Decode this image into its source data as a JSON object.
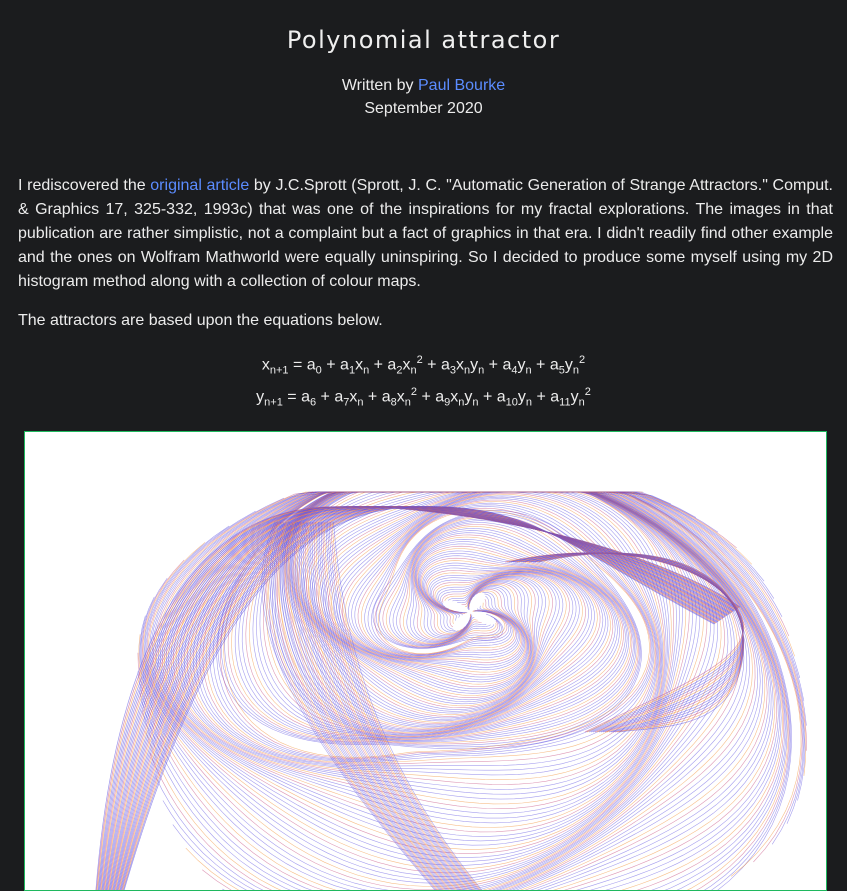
{
  "header": {
    "title": "Polynomial attractor",
    "written_by": "Written by",
    "author": "Paul Bourke",
    "date": "September 2020"
  },
  "intro": {
    "before_link": "I rediscovered the ",
    "link_text": "original article",
    "after_link": " by J.C.Sprott (Sprott, J. C. \"Automatic Generation of Strange Attractors.\" Comput. & Graphics 17, 325-332, 1993c) that was one of the inspirations for my fractal explorations. The images in that publication are rather simplistic, not a complaint but a fact of graphics in that era. I didn't readily find other example and the ones on Wolfram Mathworld were equally uninspiring. So I decided to produce some myself using my 2D histogram method along with a collection of colour maps."
  },
  "equations_intro": "The attractors are based upon the equations below.",
  "equations": {
    "x": {
      "lhs": "x",
      "lhs_sub": "n+1",
      "eq": " = ",
      "terms": [
        {
          "c": "a",
          "cs": "0",
          "v": "",
          "vs": "",
          "p": ""
        },
        {
          "c": "a",
          "cs": "1",
          "v": "x",
          "vs": "n",
          "p": ""
        },
        {
          "c": "a",
          "cs": "2",
          "v": "x",
          "vs": "n",
          "p": "2"
        },
        {
          "c": "a",
          "cs": "3",
          "v": "x",
          "vs": "n",
          "v2": "y",
          "v2s": "n",
          "p": ""
        },
        {
          "c": "a",
          "cs": "4",
          "v": "y",
          "vs": "n",
          "p": ""
        },
        {
          "c": "a",
          "cs": "5",
          "v": "y",
          "vs": "n",
          "p": "2"
        }
      ]
    },
    "y": {
      "lhs": "y",
      "lhs_sub": "n+1",
      "eq": " = ",
      "terms": [
        {
          "c": "a",
          "cs": "6",
          "v": "",
          "vs": "",
          "p": ""
        },
        {
          "c": "a",
          "cs": "7",
          "v": "x",
          "vs": "n",
          "p": ""
        },
        {
          "c": "a",
          "cs": "8",
          "v": "x",
          "vs": "n",
          "p": "2"
        },
        {
          "c": "a",
          "cs": "9",
          "v": "x",
          "vs": "n",
          "v2": "y",
          "v2s": "n",
          "p": ""
        },
        {
          "c": "a",
          "cs": "10",
          "v": "y",
          "vs": "n",
          "p": ""
        },
        {
          "c": "a",
          "cs": "11",
          "v": "y",
          "vs": "n",
          "p": "2"
        }
      ]
    }
  },
  "colors": {
    "background": "#1b1c1e",
    "text": "#ececec",
    "link": "#5b8cff",
    "figure_border": "#1fb85e",
    "attractor_primary": "#5b4fe0",
    "attractor_secondary": "#f08a2c",
    "attractor_tertiary": "#c2457a"
  }
}
